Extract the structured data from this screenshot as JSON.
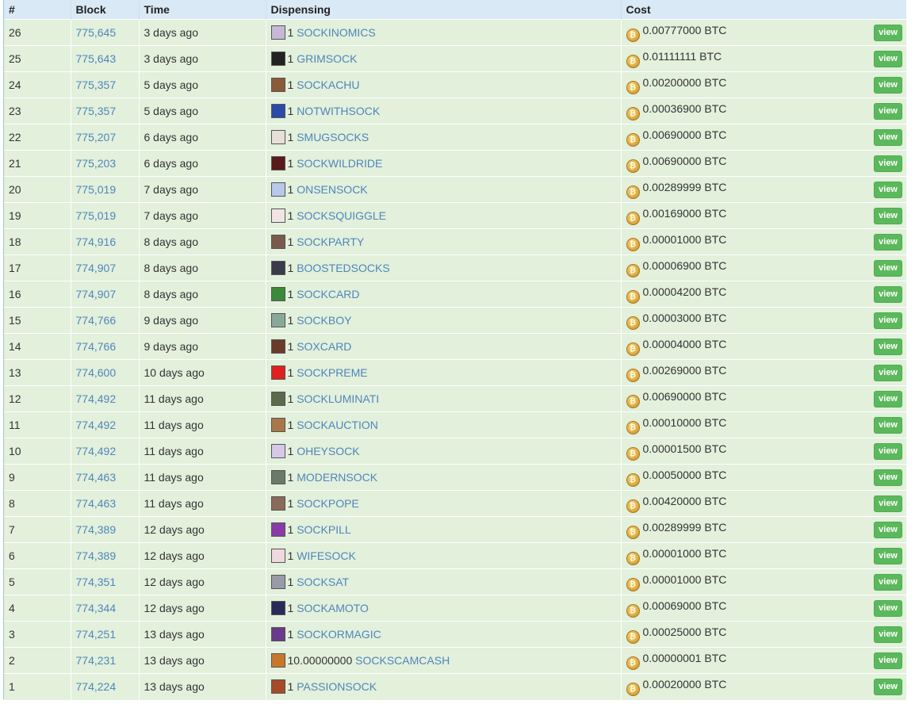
{
  "headers": {
    "num": "#",
    "block": "Block",
    "time": "Time",
    "dispensing": "Dispensing",
    "cost": "Cost"
  },
  "view_label": "view",
  "accent": "#4f86b9",
  "rows": [
    {
      "num": "26",
      "block": "775,645",
      "time": "3 days ago",
      "qty": "1",
      "asset": "SOCKINOMICS",
      "cost": "0.00777000 BTC",
      "thumb": "#c7b8d8"
    },
    {
      "num": "25",
      "block": "775,643",
      "time": "3 days ago",
      "qty": "1",
      "asset": "GRIMSOCK",
      "cost": "0.01111111 BTC",
      "thumb": "#222222"
    },
    {
      "num": "24",
      "block": "775,357",
      "time": "5 days ago",
      "qty": "1",
      "asset": "SOCKACHU",
      "cost": "0.00200000 BTC",
      "thumb": "#8a5a3a"
    },
    {
      "num": "23",
      "block": "775,357",
      "time": "5 days ago",
      "qty": "1",
      "asset": "NOTWITHSOCK",
      "cost": "0.00036900 BTC",
      "thumb": "#2c4aa8"
    },
    {
      "num": "22",
      "block": "775,207",
      "time": "6 days ago",
      "qty": "1",
      "asset": "SMUGSOCKS",
      "cost": "0.00690000 BTC",
      "thumb": "#e8e0d8"
    },
    {
      "num": "21",
      "block": "775,203",
      "time": "6 days ago",
      "qty": "1",
      "asset": "SOCKWILDRIDE",
      "cost": "0.00690000 BTC",
      "thumb": "#5a1a1a"
    },
    {
      "num": "20",
      "block": "775,019",
      "time": "7 days ago",
      "qty": "1",
      "asset": "ONSENSOCK",
      "cost": "0.00289999 BTC",
      "thumb": "#b8c8e8"
    },
    {
      "num": "19",
      "block": "775,019",
      "time": "7 days ago",
      "qty": "1",
      "asset": "SOCKSQUIGGLE",
      "cost": "0.00169000 BTC",
      "thumb": "#f2e4e4"
    },
    {
      "num": "18",
      "block": "774,916",
      "time": "8 days ago",
      "qty": "1",
      "asset": "SOCKPARTY",
      "cost": "0.00001000 BTC",
      "thumb": "#7a5a4a"
    },
    {
      "num": "17",
      "block": "774,907",
      "time": "8 days ago",
      "qty": "1",
      "asset": "BOOSTEDSOCKS",
      "cost": "0.00006900 BTC",
      "thumb": "#3a3a4a"
    },
    {
      "num": "16",
      "block": "774,907",
      "time": "8 days ago",
      "qty": "1",
      "asset": "SOCKCARD",
      "cost": "0.00004200 BTC",
      "thumb": "#3a8a3a"
    },
    {
      "num": "15",
      "block": "774,766",
      "time": "9 days ago",
      "qty": "1",
      "asset": "SOCKBOY",
      "cost": "0.00003000 BTC",
      "thumb": "#8aa89a"
    },
    {
      "num": "14",
      "block": "774,766",
      "time": "9 days ago",
      "qty": "1",
      "asset": "SOXCARD",
      "cost": "0.00004000 BTC",
      "thumb": "#6a3a2a"
    },
    {
      "num": "13",
      "block": "774,600",
      "time": "10 days ago",
      "qty": "1",
      "asset": "SOCKPREME",
      "cost": "0.00269000 BTC",
      "thumb": "#e02020"
    },
    {
      "num": "12",
      "block": "774,492",
      "time": "11 days ago",
      "qty": "1",
      "asset": "SOCKLUMINATI",
      "cost": "0.00690000 BTC",
      "thumb": "#5a6a4a"
    },
    {
      "num": "11",
      "block": "774,492",
      "time": "11 days ago",
      "qty": "1",
      "asset": "SOCKAUCTION",
      "cost": "0.00010000 BTC",
      "thumb": "#a8784a"
    },
    {
      "num": "10",
      "block": "774,492",
      "time": "11 days ago",
      "qty": "1",
      "asset": "OHEYSOCK",
      "cost": "0.00001500 BTC",
      "thumb": "#d8c8e8"
    },
    {
      "num": "9",
      "block": "774,463",
      "time": "11 days ago",
      "qty": "1",
      "asset": "MODERNSOCK",
      "cost": "0.00050000 BTC",
      "thumb": "#6a7a6a"
    },
    {
      "num": "8",
      "block": "774,463",
      "time": "11 days ago",
      "qty": "1",
      "asset": "SOCKPOPE",
      "cost": "0.00420000 BTC",
      "thumb": "#8a6a5a"
    },
    {
      "num": "7",
      "block": "774,389",
      "time": "12 days ago",
      "qty": "1",
      "asset": "SOCKPILL",
      "cost": "0.00289999 BTC",
      "thumb": "#8a3aa8"
    },
    {
      "num": "6",
      "block": "774,389",
      "time": "12 days ago",
      "qty": "1",
      "asset": "WIFESOCK",
      "cost": "0.00001000 BTC",
      "thumb": "#f0d8e0"
    },
    {
      "num": "5",
      "block": "774,351",
      "time": "12 days ago",
      "qty": "1",
      "asset": "SOCKSAT",
      "cost": "0.00001000 BTC",
      "thumb": "#9a9aa8"
    },
    {
      "num": "4",
      "block": "774,344",
      "time": "12 days ago",
      "qty": "1",
      "asset": "SOCKAMOTO",
      "cost": "0.00069000 BTC",
      "thumb": "#2a2a5a"
    },
    {
      "num": "3",
      "block": "774,251",
      "time": "13 days ago",
      "qty": "1",
      "asset": "SOCKORMAGIC",
      "cost": "0.00025000 BTC",
      "thumb": "#6a3a8a"
    },
    {
      "num": "2",
      "block": "774,231",
      "time": "13 days ago",
      "qty": "10.00000000",
      "asset": "SOCKSCAMCASH",
      "cost": "0.00000001 BTC",
      "thumb": "#c8782a"
    },
    {
      "num": "1",
      "block": "774,224",
      "time": "13 days ago",
      "qty": "1",
      "asset": "PASSIONSOCK",
      "cost": "0.00020000 BTC",
      "thumb": "#a84a2a"
    }
  ]
}
